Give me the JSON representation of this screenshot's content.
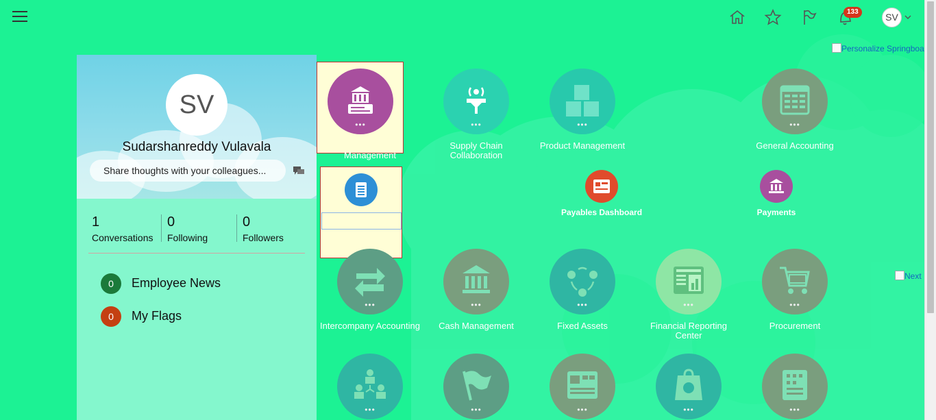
{
  "header": {
    "menu_icon": "hamburger-icon",
    "icons": [
      "home-icon",
      "star-icon",
      "flag-icon",
      "notifications-icon"
    ],
    "notification_count": "133",
    "user_initials": "SV"
  },
  "links": {
    "personalize": "Personalize Springboard",
    "next": "Next"
  },
  "profile": {
    "initials": "SV",
    "name": "Sudarshanreddy Vulavala",
    "share_placeholder": "Share thoughts with your colleagues...",
    "stats": [
      {
        "value": "1",
        "label": "Conversations"
      },
      {
        "value": "0",
        "label": "Following"
      },
      {
        "value": "0",
        "label": "Followers"
      }
    ],
    "news": [
      {
        "count": "0",
        "label": "Employee News",
        "color": "#1b7a3a"
      },
      {
        "count": "0",
        "label": "My Flags",
        "color": "#c44012"
      }
    ]
  },
  "tiles": {
    "row1": [
      {
        "label": "Management",
        "color": "#a84f9e",
        "icon": "bank-document-icon"
      },
      {
        "label": "Supply Chain Collaboration",
        "color": "#2bd2b0",
        "icon": "antenna-icon"
      },
      {
        "label": "Product Management",
        "color": "#28c9ac",
        "icon": "boxes-icon"
      },
      {
        "label": "General Accounting",
        "color": "#7a9e7e",
        "icon": "ledger-icon"
      }
    ],
    "row1_small": [
      {
        "label": "Payables Dashboard",
        "color": "#e04b2c",
        "icon": "dashboard-icon"
      },
      {
        "label": "Payments",
        "color": "#a84f9e",
        "icon": "bank-icon"
      }
    ],
    "row2": [
      {
        "label": "Intercompany Accounting",
        "color": "#5d9e85",
        "icon": "exchange-arrows-icon"
      },
      {
        "label": "Cash Management",
        "color": "#7a9e7e",
        "icon": "bank-icon"
      },
      {
        "label": "Fixed Assets",
        "color": "#2fb6a3",
        "icon": "cycle-icon"
      },
      {
        "label": "Financial Reporting Center",
        "color": "#8ee6a5",
        "icon": "report-icon"
      },
      {
        "label": "Procurement",
        "color": "#7a9e7e",
        "icon": "cart-icon"
      }
    ],
    "row3": [
      {
        "label": "",
        "color": "#2fb6a3",
        "icon": "org-chart-icon"
      },
      {
        "label": "",
        "color": "#5d9e85",
        "icon": "flag-icon"
      },
      {
        "label": "",
        "color": "#7a9e7e",
        "icon": "dashboard-icon"
      },
      {
        "label": "",
        "color": "#2fb6a3",
        "icon": "shopping-bag-icon"
      },
      {
        "label": "",
        "color": "#7a9e7e",
        "icon": "building-icon"
      }
    ],
    "popup_icon": "document-icon",
    "popup_color": "#2d8fd6"
  }
}
